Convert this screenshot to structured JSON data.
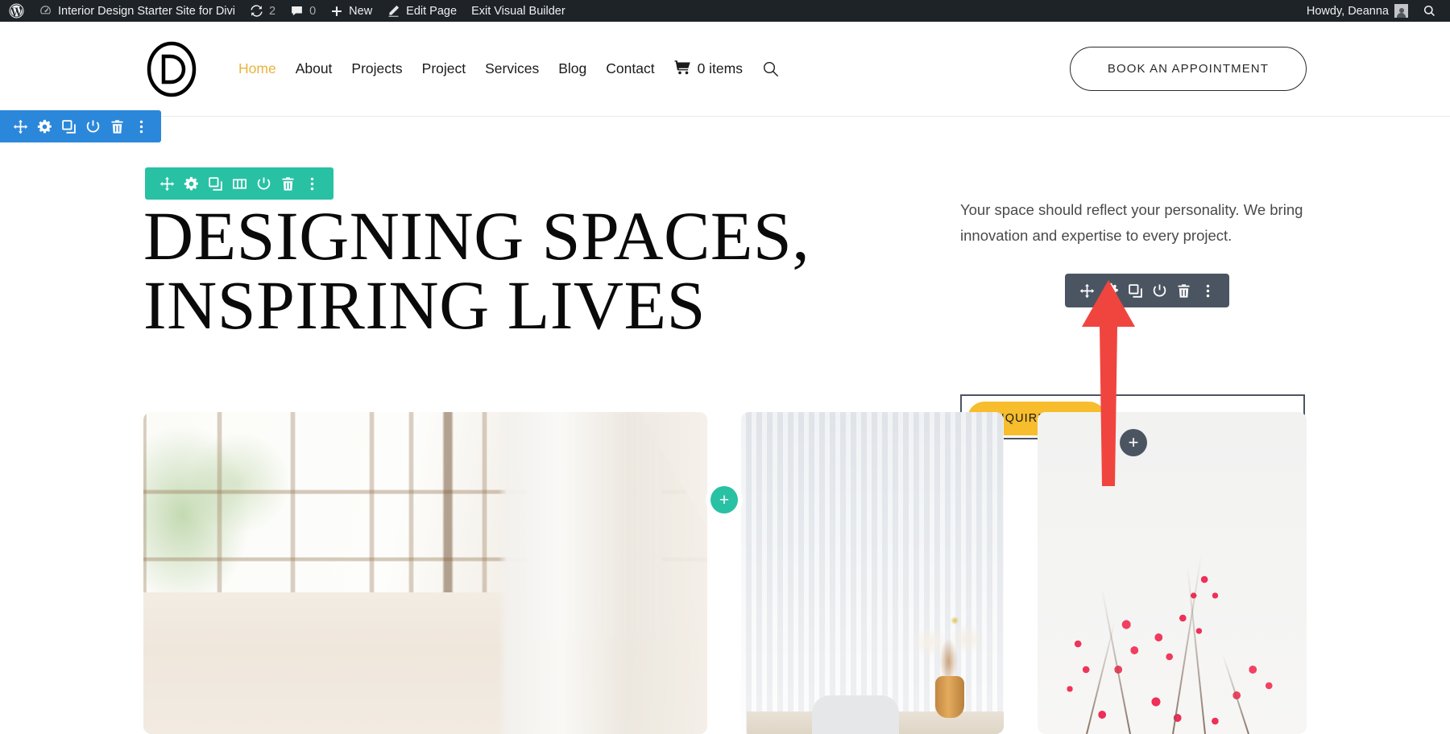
{
  "admin_bar": {
    "wp_logo_icon": "wordpress-logo-icon",
    "dashboard_icon": "dashboard-speedometer-icon",
    "site_title": "Interior Design Starter Site for Divi",
    "updates_icon": "updates-refresh-icon",
    "updates_count": "2",
    "comments_icon": "comments-bubble-icon",
    "comments_count": "0",
    "new_icon": "plus-icon",
    "new_label": "New",
    "edit_icon": "pencil-edit-icon",
    "edit_label": "Edit Page",
    "exit_builder_label": "Exit Visual Builder",
    "howdy": "Howdy, Deanna",
    "avatar_icon": "user-avatar-icon",
    "search_icon": "search-icon",
    "background_color": "#1d2327",
    "text_color": "#f0f0f1"
  },
  "site_header": {
    "logo_letter": "D",
    "logo_name": "divi-d-logo",
    "nav_items": [
      {
        "label": "Home",
        "active": true
      },
      {
        "label": "About",
        "active": false
      },
      {
        "label": "Projects",
        "active": false
      },
      {
        "label": "Project",
        "active": false
      },
      {
        "label": "Services",
        "active": false
      },
      {
        "label": "Blog",
        "active": false
      },
      {
        "label": "Contact",
        "active": false
      }
    ],
    "cart_icon": "shopping-cart-icon",
    "cart_label": "0 items",
    "search_icon": "search-magnifier-icon",
    "appointment_button": "BOOK AN APPOINTMENT",
    "active_color": "#e8b33c"
  },
  "builder": {
    "section_toolbar": {
      "color": "#2b87da",
      "buttons": [
        {
          "name": "move-section-button",
          "icon": "move-arrows-icon"
        },
        {
          "name": "section-settings-button",
          "icon": "gear-icon"
        },
        {
          "name": "duplicate-section-button",
          "icon": "duplicate-icon"
        },
        {
          "name": "disable-section-button",
          "icon": "power-icon"
        },
        {
          "name": "delete-section-button",
          "icon": "trash-icon"
        },
        {
          "name": "section-more-options-button",
          "icon": "kebab-menu-icon"
        }
      ]
    },
    "row_toolbar": {
      "color": "#28c1a4",
      "buttons": [
        {
          "name": "move-row-button",
          "icon": "move-arrows-icon"
        },
        {
          "name": "row-settings-button",
          "icon": "gear-icon"
        },
        {
          "name": "duplicate-row-button",
          "icon": "duplicate-icon"
        },
        {
          "name": "column-structure-button",
          "icon": "columns-icon"
        },
        {
          "name": "disable-row-button",
          "icon": "power-icon"
        },
        {
          "name": "delete-row-button",
          "icon": "trash-icon"
        },
        {
          "name": "row-more-options-button",
          "icon": "kebab-menu-icon"
        }
      ]
    },
    "module_toolbar": {
      "color": "#4b5562",
      "buttons": [
        {
          "name": "move-module-button",
          "icon": "move-arrows-icon"
        },
        {
          "name": "module-settings-button",
          "icon": "gear-icon"
        },
        {
          "name": "duplicate-module-button",
          "icon": "duplicate-icon"
        },
        {
          "name": "disable-module-button",
          "icon": "power-icon"
        },
        {
          "name": "delete-module-button",
          "icon": "trash-icon"
        },
        {
          "name": "module-more-options-button",
          "icon": "kebab-menu-icon"
        }
      ]
    },
    "add_row_button": {
      "icon": "plus-icon",
      "label": "+",
      "color": "#28c1a4"
    },
    "add_module_button": {
      "icon": "plus-icon",
      "label": "+",
      "color": "#4b5562"
    },
    "annotation": {
      "type": "arrow",
      "color": "#f0453e",
      "points_to": "module-settings-button"
    }
  },
  "hero": {
    "heading": "DESIGNING SPACES, INSPIRING LIVES",
    "paragraph": "Your space should reflect your personality. We bring innovation and expertise to every project.",
    "cta_label": "INQUIRE NOW",
    "cta_color": "#f7bd2c"
  },
  "gallery": {
    "items": [
      {
        "name": "gallery-image-window",
        "alt": "Bright industrial window with white brick wall"
      },
      {
        "name": "gallery-image-curtain",
        "alt": "Sheer white curtain with chair and dried floral vase"
      },
      {
        "name": "gallery-image-berries",
        "alt": "Red berry branches against light background"
      }
    ]
  }
}
